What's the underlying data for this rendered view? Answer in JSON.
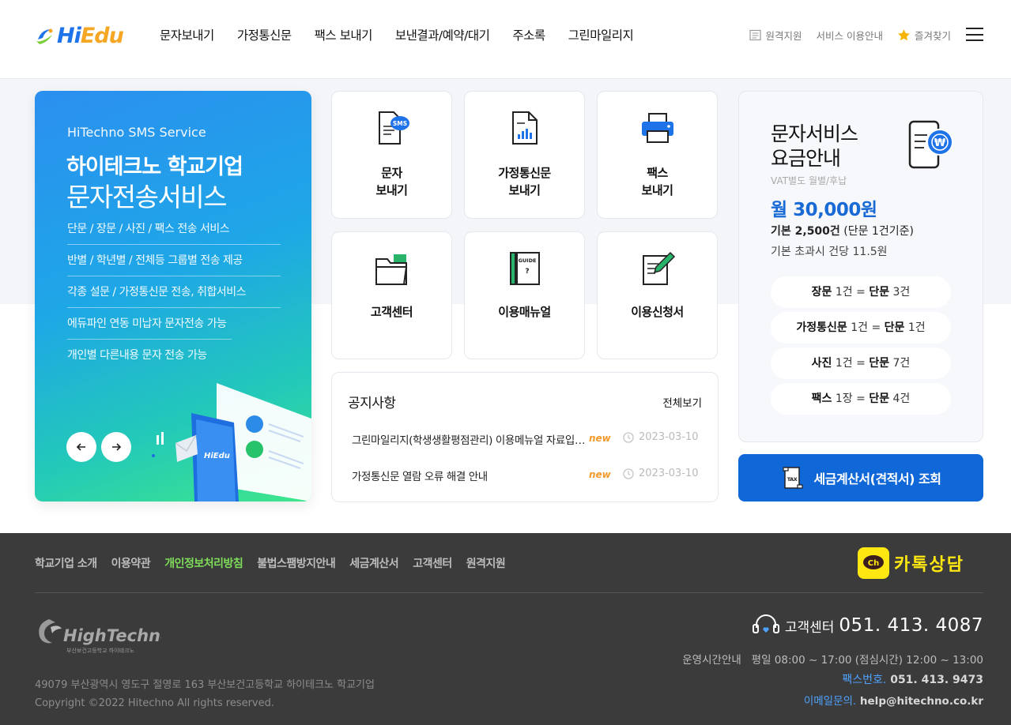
{
  "header": {
    "logo_hi": "Hi",
    "logo_edu": "Edu",
    "nav": [
      "문자보내기",
      "가정통신문",
      "팩스 보내기",
      "보낸결과/예약/대기",
      "주소록",
      "그린마일리지"
    ],
    "util": {
      "remote": "원격지원",
      "guide": "서비스 이용안내",
      "fav": "즐겨찾기"
    }
  },
  "banner": {
    "sub": "HiTechno SMS Service",
    "title1": "하이테크노 학교기업",
    "title2": "문자전송서비스",
    "items": [
      "단문 / 장문 / 사진 / 팩스 전송 서비스",
      "반별 / 학년별 / 전체등 그룹별 전송 제공",
      "각종 설문 / 가정통신문 전송, 취합서비스",
      "에듀파인 연동 미납자 문자전송 가능",
      "개인별 다른내용 문자 전송 가능"
    ],
    "illu_text": "HiEdu",
    "sms_badge": "SMS",
    "guide_badge": "GUIDE"
  },
  "tiles": [
    {
      "l1": "문자",
      "l2": "보내기",
      "icon": "sms-doc-icon"
    },
    {
      "l1": "가정통신문",
      "l2": "보내기",
      "icon": "chart-doc-icon"
    },
    {
      "l1": "팩스",
      "l2": "보내기",
      "icon": "printer-icon"
    },
    {
      "l1": "고객센터",
      "icon": "folder-icon"
    },
    {
      "l1": "이용매뉴얼",
      "icon": "guide-book-icon"
    },
    {
      "l1": "이용신청서",
      "icon": "pen-doc-icon"
    }
  ],
  "notice": {
    "title": "공지사항",
    "more": "전체보기",
    "items": [
      {
        "text": "그린마일리지(학생생활평점관리) 이용메뉴얼 자료입니다",
        "badge": "new",
        "date": "2023-03-10"
      },
      {
        "text": "가정통신문 열람 오류 해결 안내",
        "badge": "new",
        "date": "2023-03-10"
      }
    ]
  },
  "pricing": {
    "title1": "문자서비스",
    "title2": "요금안내",
    "vat": "VAT별도 월별/후납",
    "amount": "월 30,000원",
    "base_b": "기본 2,500건",
    "base_rest": " (단문 1건기준)",
    "over": "기본 초과시 건당 11.5원",
    "rates": [
      {
        "a": "장문",
        "an": " 1건 = ",
        "b": "단문",
        "bn": " 3건"
      },
      {
        "a": "가정통신문",
        "an": " 1건 = ",
        "b": "단문",
        "bn": " 1건"
      },
      {
        "a": "사진",
        "an": " 1건 = ",
        "b": "단문",
        "bn": " 7건"
      },
      {
        "a": "팩스",
        "an": " 1장 = ",
        "b": "단문",
        "bn": " 4건"
      }
    ]
  },
  "tax_button": "세금계산서(견적서) 조회",
  "tax_badge": "TAX",
  "footer": {
    "nav": [
      "학교기업 소개",
      "이용약관",
      "개인정보처리방침",
      "불법스팸방지안내",
      "세금계산서",
      "고객센터",
      "원격지원"
    ],
    "kakao_icon": "Ch",
    "kakao": "카톡상담",
    "brand": "HighTechno",
    "brand_sub": "부산보건고등학교 하이테크노",
    "address": "49079 부산광역시 영도구 절영로 163 부산보건고등학교 하이테크노 학교기업",
    "copyright": "Copyright ©2022 Hitechno All rights reserved.",
    "cs_label": "고객센터",
    "cs_number": "051. 413. 4087",
    "hours": "운영시간안내   평일 08:00 ~ 17:00 (점심시간) 12:00 ~ 13:00",
    "fax_label": "팩스번호.",
    "fax_number": " 051. 413. 9473",
    "mail_label": "이메일문의.",
    "mail": " help@hitechno.co.kr"
  }
}
